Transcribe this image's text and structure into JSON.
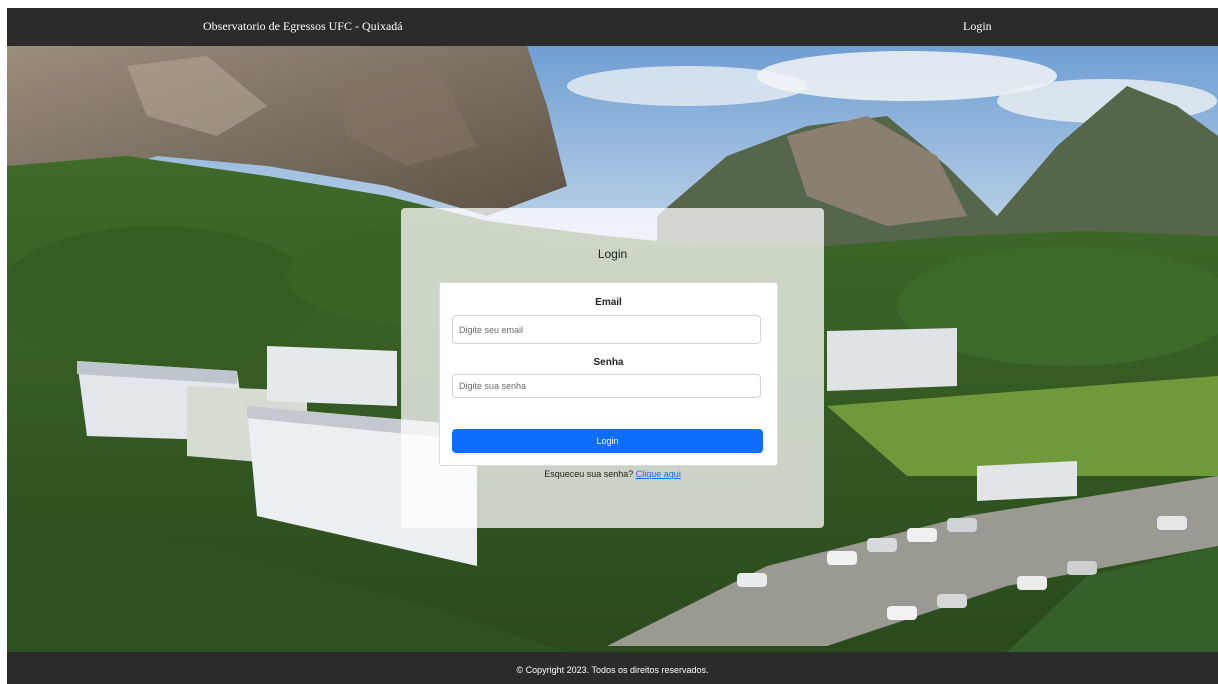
{
  "navbar": {
    "title": "Observatorio de Egressos UFC - Quixadá",
    "login_link": "Login"
  },
  "card": {
    "title": "Login",
    "email_label": "Email",
    "email_placeholder": "Digite seu email",
    "password_label": "Senha",
    "password_placeholder": "Digite sua senha",
    "submit_label": "Login",
    "forgot_text": "Esqueceu sua senha?",
    "forgot_link": "Clique aqui"
  },
  "footer": {
    "copyright": "© Copyright 2023. Todos os direitos reservados."
  },
  "colors": {
    "navbar_bg": "#2b2b2b",
    "primary_button": "#0d6efd",
    "link": "#0d6efd"
  }
}
